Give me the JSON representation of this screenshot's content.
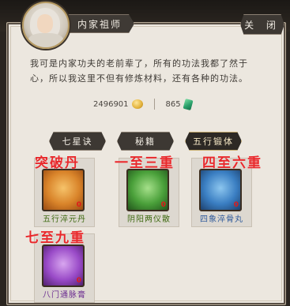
{
  "header": {
    "name": "内家祖师",
    "close_label": "关  闭"
  },
  "dialog": {
    "text": "我可是内家功夫的老前辈了，所有的功法我都了然于心，所以我这里不但有修炼材料，还有各种的功法。"
  },
  "currency": {
    "gold": "2496901",
    "jade": "865",
    "gold_icon": "gold-ingot-icon",
    "jade_icon": "jade-icon"
  },
  "tabs": [
    {
      "label": "七星诀",
      "active": false
    },
    {
      "label": "秘籍",
      "active": false
    },
    {
      "label": "五行锻体",
      "active": true
    }
  ],
  "items": [
    {
      "name": "五行淬元丹",
      "count": "0",
      "frame": "orange",
      "icon": "elixir-pill-icon"
    },
    {
      "name": "阴阳两仪散",
      "count": "0",
      "frame": "green",
      "icon": "yin-yang-powder-icon"
    },
    {
      "name": "四象淬骨丸",
      "count": "0",
      "frame": "blue",
      "icon": "bone-tempering-pill-icon"
    },
    {
      "name": "八门通脉膏",
      "count": "0",
      "frame": "purple",
      "icon": "meridian-ointment-icon"
    }
  ],
  "annotations": [
    "突破丹",
    "一至三重",
    "四至六重",
    "七至九重"
  ],
  "colors": {
    "panel": "#ece7df",
    "annotation": "#e8282b",
    "tab_active_border": "#c7ad6f"
  }
}
